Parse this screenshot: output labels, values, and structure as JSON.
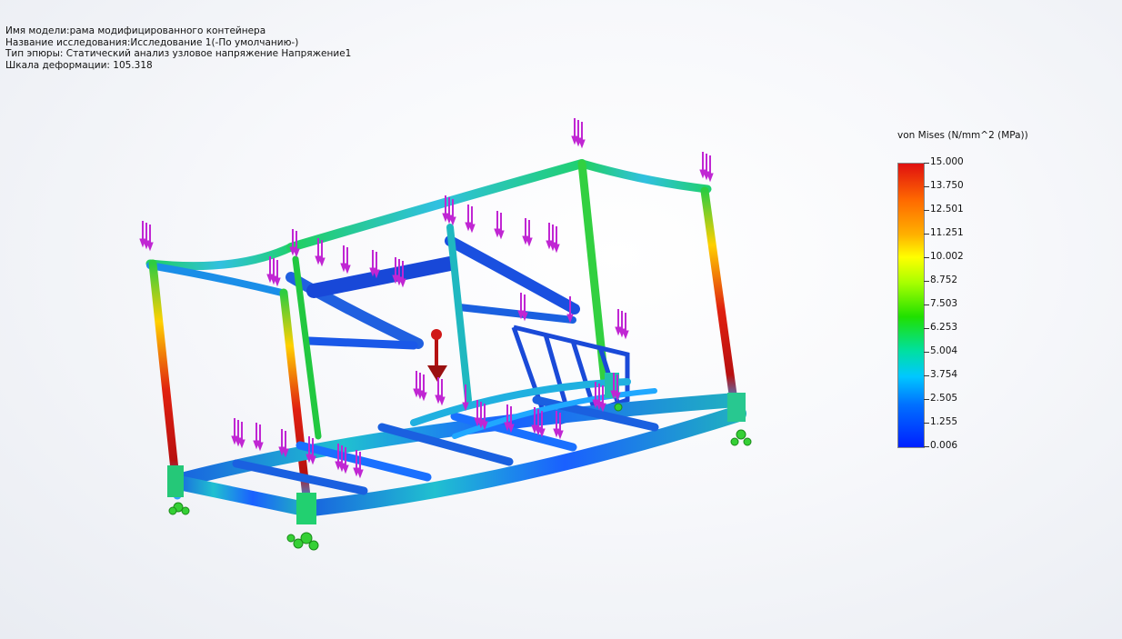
{
  "info": {
    "model_name": "Имя модели:рама модифицированного контейнера",
    "study_name": "Название исследования:Исследование 1(-По умолчанию-)",
    "plot_type": "Тип эпюры: Статический анализ узловое напряжение Напряжение1",
    "deformation_scale": "Шкала деформации: 105.318"
  },
  "legend": {
    "title": "von Mises (N/mm^2 (MPa))",
    "ticks": [
      "15.000",
      "13.750",
      "12.501",
      "11.251",
      "10.002",
      "8.752",
      "7.503",
      "6.253",
      "5.004",
      "3.754",
      "2.505",
      "1.255",
      "0.006"
    ],
    "colors": {
      "max": "#e01010",
      "high": "#ff6a00",
      "mid_high": "#ffff00",
      "mid": "#20e000",
      "mid_low": "#00c8ff",
      "min": "#0020ff"
    }
  },
  "scene": {
    "load_arrow_color": "#c026d3",
    "gravity_arrow_color": "#b51212",
    "fixture_color": "#35d035",
    "icons": [
      "load-arrow-icon",
      "gravity-icon",
      "fixture-icon"
    ]
  }
}
